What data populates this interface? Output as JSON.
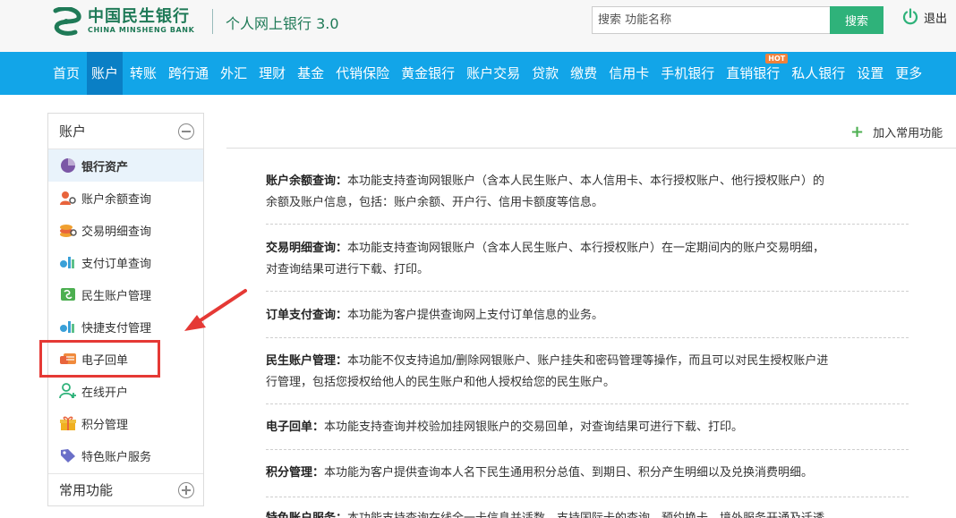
{
  "header": {
    "logo_cn": "中国民生银行",
    "logo_en": "CHINA MINSHENG BANK",
    "subtitle": "个人网上银行 3.0",
    "search_placeholder": "搜索 功能名称",
    "search_button": "搜索",
    "logout": "退出"
  },
  "nav": {
    "items": [
      "首页",
      "账户",
      "转账",
      "跨行通",
      "外汇",
      "理财",
      "基金",
      "代销保险",
      "黄金银行",
      "账户交易",
      "贷款",
      "缴费",
      "信用卡",
      "手机银行",
      "直销银行",
      "私人银行",
      "设置",
      "更多"
    ],
    "active_index": 1,
    "hot_index": 14,
    "hot_label": "HOT"
  },
  "sidebar": {
    "title": "账户",
    "items": [
      {
        "label": "银行资产",
        "icon": "pie-chart-icon"
      },
      {
        "label": "账户余额查询",
        "icon": "user-search-icon"
      },
      {
        "label": "交易明细查询",
        "icon": "coins-search-icon"
      },
      {
        "label": "支付订单查询",
        "icon": "payment-order-icon"
      },
      {
        "label": "民生账户管理",
        "icon": "account-card-icon"
      },
      {
        "label": "快捷支付管理",
        "icon": "quick-pay-icon"
      },
      {
        "label": "电子回单",
        "icon": "receipt-icon"
      },
      {
        "label": "在线开户",
        "icon": "user-add-icon"
      },
      {
        "label": "积分管理",
        "icon": "gift-icon"
      },
      {
        "label": "特色账户服务",
        "icon": "tag-icon"
      }
    ],
    "footer_title": "常用功能"
  },
  "main": {
    "add_favorite": "加入常用功能",
    "descriptions": [
      {
        "title": "账户余额查询：",
        "line1": "本功能支持查询网银账户（含本人民生账户、本人信用卡、本行授权账户、他行授权账户）的",
        "line2": "余额及账户信息，包括：账户余额、开户行、信用卡额度等信息。"
      },
      {
        "title": "交易明细查询：",
        "line1": "本功能支持查询网银账户（含本人民生账户、本行授权账户）在一定期间内的账户交易明细，",
        "line2": "对查询结果可进行下载、打印。"
      },
      {
        "title": "订单支付查询：",
        "line1": "本功能为客户提供查询网上支付订单信息的业务。",
        "line2": ""
      },
      {
        "title": "民生账户管理：",
        "line1": "本功能不仅支持追加/删除网银账户、账户挂失和密码管理等操作，而且可以对民生授权账户进",
        "line2": "行管理，包括您授权给他人的民生账户和他人授权给您的民生账户。"
      },
      {
        "title": "电子回单：",
        "line1": "本功能支持查询并校验加挂网银账户的交易回单，对查询结果可进行下载、打印。",
        "line2": ""
      },
      {
        "title": "积分管理：",
        "line1": "本功能为客户提供查询本人名下民生通用积分总值、到期日、积分产生明细以及兑换消费明细。",
        "line2": ""
      },
      {
        "title": "特色账户服务：",
        "line1": "本功能支持查询在线全一卡信息并适数，支持国际卡的查询、预约换卡、境外服务开通及迁透",
        "line2": ""
      }
    ]
  },
  "colors": {
    "brand_green": "#1f7a57",
    "nav_blue": "#12a5e8",
    "nav_active": "#0a7fc5",
    "search_green": "#2fb27a",
    "annotation_red": "#e53935"
  }
}
